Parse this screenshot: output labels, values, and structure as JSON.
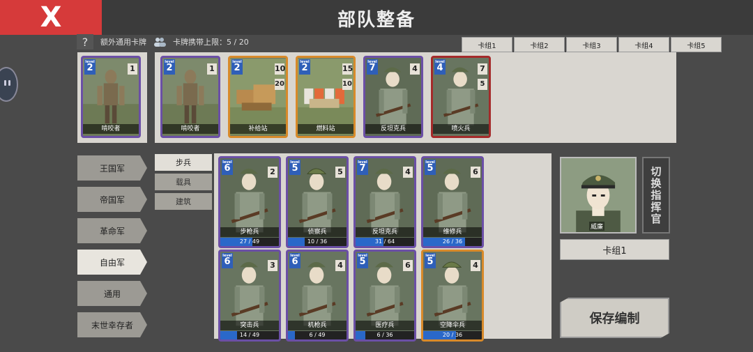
{
  "header": {
    "close_label": "X",
    "title": "部队整备",
    "status_text": ""
  },
  "info": {
    "help_label": "?",
    "extra_cards_label": "额外通用卡牌",
    "carry_limit_label": "卡牌携带上限：",
    "carry_limit_value": "5 / 20"
  },
  "deck_tabs": [
    "卡组1",
    "卡组2",
    "卡组3",
    "卡组4",
    "卡组5"
  ],
  "extra_card": {
    "level": "2",
    "cost": "1",
    "name": "啃咬者",
    "border": "#6b4fa6"
  },
  "bar_cards": [
    {
      "level": "2",
      "cost": "1",
      "cost2": "",
      "name": "啃咬者",
      "border": "#6b4fa6",
      "art": "zombie"
    },
    {
      "level": "2",
      "cost": "10",
      "cost2": "20",
      "name": "补给站",
      "border": "#d88a2a",
      "art": "crates"
    },
    {
      "level": "2",
      "cost": "15",
      "cost2": "10",
      "name": "燃料站",
      "border": "#d88a2a",
      "art": "barrels"
    },
    {
      "level": "7",
      "cost": "4",
      "cost2": "",
      "name": "反坦克兵",
      "border": "#6b4fa6",
      "art": "soldier"
    },
    {
      "level": "4",
      "cost": "7",
      "cost2": "5",
      "name": "喷火兵",
      "border": "#a52a2a",
      "art": "soldier2"
    }
  ],
  "factions": [
    "王国军",
    "帝国军",
    "革命军",
    "自由军",
    "通用",
    "末世幸存者"
  ],
  "active_faction": 3,
  "categories": [
    "步兵",
    "载具",
    "建筑"
  ],
  "grid_cards": [
    {
      "level": "6",
      "cost": "2",
      "name": "步枪兵",
      "progress_text": "27 / 49",
      "progress": 0.55,
      "border": "#6b4fa6"
    },
    {
      "level": "5",
      "cost": "5",
      "name": "侦察兵",
      "progress_text": "10 / 36",
      "progress": 0.28,
      "border": "#6b4fa6"
    },
    {
      "level": "7",
      "cost": "4",
      "name": "反坦克兵",
      "progress_text": "31 / 64",
      "progress": 0.48,
      "border": "#6b4fa6"
    },
    {
      "level": "5",
      "cost": "6",
      "name": "维修兵",
      "progress_text": "26 / 36",
      "progress": 0.72,
      "border": "#6b4fa6"
    },
    {
      "level": "6",
      "cost": "3",
      "name": "突击兵",
      "progress_text": "14 / 49",
      "progress": 0.29,
      "border": "#6b4fa6"
    },
    {
      "level": "6",
      "cost": "4",
      "name": "机枪兵",
      "progress_text": "6 / 49",
      "progress": 0.12,
      "border": "#6b4fa6"
    },
    {
      "level": "5",
      "cost": "6",
      "name": "医疗兵",
      "progress_text": "6 / 36",
      "progress": 0.17,
      "border": "#6b4fa6"
    },
    {
      "level": "5",
      "cost": "4",
      "name": "空降伞兵",
      "progress_text": "20 / 36",
      "progress": 0.56,
      "border": "#d88a2a"
    }
  ],
  "commander": {
    "name": "威廉",
    "switch_label": "切换指挥官"
  },
  "deck_name": "卡组1",
  "save_label": "保存编制",
  "level_tag": "level"
}
